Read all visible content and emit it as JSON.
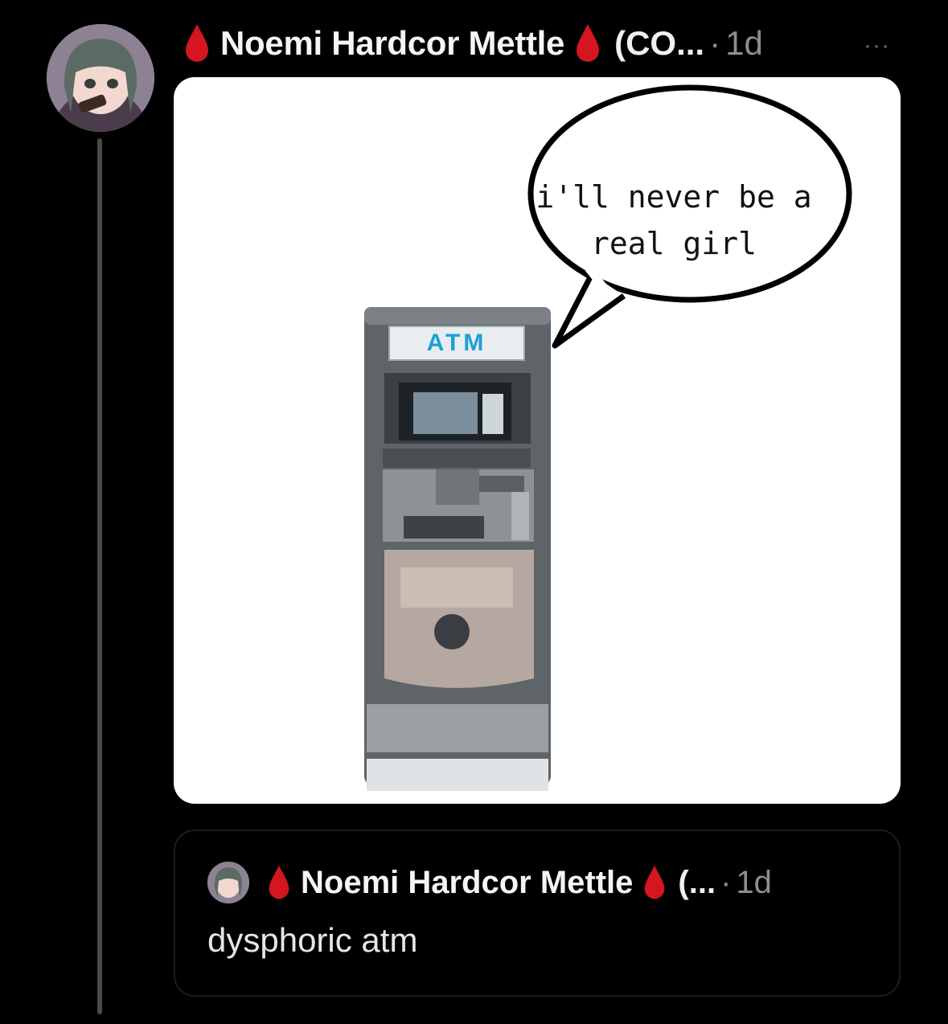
{
  "post": {
    "author_name": "Noemi Hardcor Mettle",
    "author_handle": "(CO...",
    "separator": "·",
    "time": "1d",
    "more_label": "···",
    "badge_icon": "blood-drop-icon",
    "media": {
      "speech_bubble_lines": [
        "i'll never be a",
        "real girl"
      ],
      "atm_sign": "ATM"
    }
  },
  "quoted_post": {
    "author_name": "Noemi Hardcor Mettle",
    "author_handle": "(...",
    "separator": "·",
    "time": "1d",
    "text": "dysphoric atm"
  },
  "colors": {
    "background": "#000000",
    "drop_red": "#d3161f",
    "muted_text": "#8e8e8e",
    "atm_sign_blue": "#1aa0d8"
  }
}
